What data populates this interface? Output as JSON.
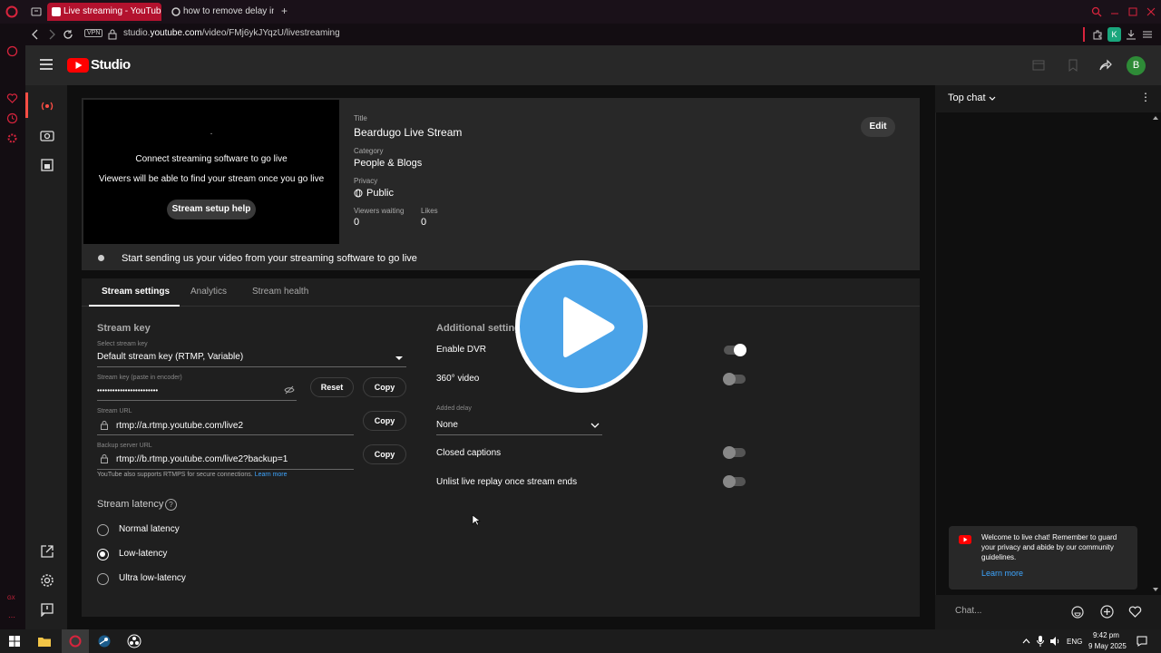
{
  "browser": {
    "tabs": [
      {
        "title": "Live streaming - YouTube"
      },
      {
        "title": "how to remove delay in yo"
      }
    ],
    "new_tab": "+",
    "vpn_badge": "VPN",
    "url_prefix": "studio.",
    "url_domain": "youtube.com",
    "url_path": "/video/FMj6ykJYqzU/livestreaming",
    "profile_initial": "K",
    "opera_sidebar_label": "GX"
  },
  "studio": {
    "logo_text": "Studio",
    "avatar_initial": "B"
  },
  "preview": {
    "dot": ".",
    "connect_text": "Connect streaming software to go live",
    "viewers_text": "Viewers will be able to find your stream once you go live",
    "help_button": "Stream setup help"
  },
  "details": {
    "title_label": "Title",
    "title_value": "Beardugo Live Stream",
    "category_label": "Category",
    "category_value": "People & Blogs",
    "privacy_label": "Privacy",
    "privacy_value": "Public",
    "viewers_waiting_label": "Viewers waiting",
    "viewers_waiting_value": "0",
    "likes_label": "Likes",
    "likes_value": "0",
    "edit_button": "Edit"
  },
  "status_message": "Start sending us your video from your streaming software to go live",
  "tabs": [
    {
      "label": "Stream settings",
      "selected": true
    },
    {
      "label": "Analytics",
      "selected": false
    },
    {
      "label": "Stream health",
      "selected": false
    }
  ],
  "stream_key": {
    "heading": "Stream key",
    "select_label": "Select stream key",
    "select_value": "Default stream key (RTMP, Variable)",
    "key_label": "Stream key (paste in encoder)",
    "key_value": "••••••••••••••••••••••••",
    "reset_button": "Reset",
    "copy_button": "Copy",
    "url_label": "Stream URL",
    "url_value": "rtmp://a.rtmp.youtube.com/live2",
    "backup_label": "Backup server URL",
    "backup_value": "rtmp://b.rtmp.youtube.com/live2?backup=1",
    "rtmps_note": "YouTube also supports RTMPS for secure connections.",
    "learn_more": "Learn more"
  },
  "latency": {
    "heading": "Stream latency",
    "help": "?",
    "options": [
      {
        "label": "Normal latency",
        "selected": false
      },
      {
        "label": "Low-latency",
        "selected": true
      },
      {
        "label": "Ultra low-latency",
        "selected": false
      }
    ]
  },
  "additional": {
    "heading": "Additional settings",
    "dvr_label": "Enable DVR",
    "dvr_on": true,
    "video360_label": "360° video",
    "video360_on": false,
    "delay_label": "Added delay",
    "delay_value": "None",
    "captions_label": "Closed captions",
    "captions_on": false,
    "unlist_label": "Unlist live replay once stream ends",
    "unlist_on": false
  },
  "chat": {
    "mode": "Top chat",
    "welcome_text": "Welcome to live chat! Remember to guard your privacy and abide by our community guidelines.",
    "welcome_link": "Learn more",
    "placeholder": "Chat..."
  },
  "taskbar": {
    "lang": "ENG",
    "time": "9:42 pm",
    "date": "9 May 2025"
  },
  "colors": {
    "accent_red": "#ff0000",
    "link_blue": "#3ea6ff",
    "play_blue": "#4aa3e8"
  }
}
